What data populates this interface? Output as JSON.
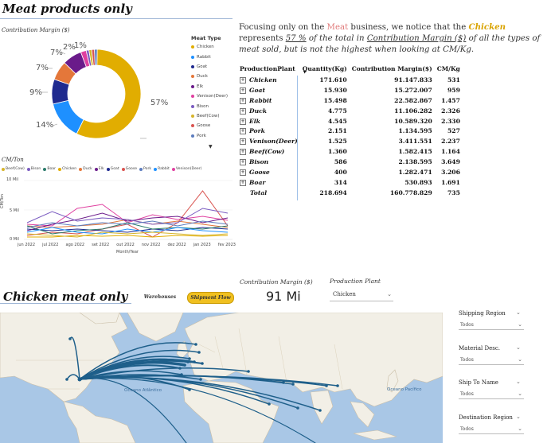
{
  "header1": {
    "title": "Meat products only"
  },
  "donut": {
    "title": "Contribution Margin ($)",
    "slices": [
      {
        "name": "Chicken",
        "pct": 57,
        "color": "#e1ad01"
      },
      {
        "name": "Rabbit",
        "pct": 14,
        "color": "#1e90ff"
      },
      {
        "name": "Goat",
        "pct": 9,
        "color": "#1f2a8f"
      },
      {
        "name": "Duck",
        "pct": 7,
        "color": "#e4773a"
      },
      {
        "name": "Elk",
        "pct": 7,
        "color": "#6a1b8a"
      },
      {
        "name": "Venison(Deer)",
        "pct": 2,
        "color": "#e040a0"
      },
      {
        "name": "Bison",
        "pct": 1,
        "color": "#7a5bc0"
      },
      {
        "name": "Beef(Cow)",
        "pct": 1,
        "color": "#d6b42a"
      },
      {
        "name": "Goose",
        "pct": 1,
        "color": "#d9534f"
      },
      {
        "name": "Pork",
        "pct": 1,
        "color": "#5c7cbe"
      }
    ],
    "labels": {
      "p57": "57%",
      "p14": "14%",
      "p9": "9%",
      "p7a": "7%",
      "p7b": "7%",
      "p2": "2%",
      "p1": "1%"
    }
  },
  "legend": {
    "title": "Meat Type",
    "items": [
      {
        "label": "Chicken",
        "color": "#e1ad01"
      },
      {
        "label": "Rabbit",
        "color": "#1e90ff"
      },
      {
        "label": "Goat",
        "color": "#1f2a8f"
      },
      {
        "label": "Duck",
        "color": "#e4773a"
      },
      {
        "label": "Elk",
        "color": "#6a1b8a"
      },
      {
        "label": "Venison(Deer)",
        "color": "#e040a0"
      },
      {
        "label": "Bison",
        "color": "#7a5bc0"
      },
      {
        "label": "Beef(Cow)",
        "color": "#d6b42a"
      },
      {
        "label": "Goose",
        "color": "#d9534f"
      },
      {
        "label": "Pork",
        "color": "#5c7cbe"
      }
    ],
    "more_arrow": "▼"
  },
  "line_chart": {
    "title": "CM/Ton",
    "legend": [
      {
        "label": "Beef(Cow)",
        "color": "#d6b42a"
      },
      {
        "label": "Bison",
        "color": "#7a5bc0"
      },
      {
        "label": "Boar",
        "color": "#2a7a6a"
      },
      {
        "label": "Chicken",
        "color": "#e1ad01"
      },
      {
        "label": "Duck",
        "color": "#e4773a"
      },
      {
        "label": "Elk",
        "color": "#6a1b8a"
      },
      {
        "label": "Goat",
        "color": "#1f2a8f"
      },
      {
        "label": "Goose",
        "color": "#d9534f"
      },
      {
        "label": "Pork",
        "color": "#5c7cbe"
      },
      {
        "label": "Rabbit",
        "color": "#1e90ff"
      },
      {
        "label": "Venison(Deer)",
        "color": "#e040a0"
      }
    ],
    "y_ticks": [
      "10 Mil",
      "5 Mil",
      "0 Mil"
    ],
    "y_label": "CM/Ton",
    "x_ticks": [
      "jun 2022",
      "jul 2022",
      "ago 2022",
      "set 2022",
      "out 2022",
      "nov 2022",
      "dez 2022",
      "jan 2023",
      "fev 2023"
    ],
    "x_label": "Month/Year"
  },
  "paragraph": {
    "p1": "Focusing only on the ",
    "meat": "Meat",
    "p2": " business, we notice that the ",
    "chicken": "Chicken",
    "p3": " represents ",
    "pct": "57 %",
    "p4": " of the total in ",
    "cm": "Contribution Margin ($)",
    "p5": " of all the types of meat sold, but is not the highest when looking at CM/Kg."
  },
  "table": {
    "headers": [
      "ProductionPlant",
      "Quantity(Kg)",
      "Contribution Margin($)",
      "CM/Kg"
    ],
    "rows": [
      [
        "Chicken",
        "171.610",
        "91.147.833",
        "531"
      ],
      [
        "Goat",
        "15.930",
        "15.272.007",
        "959"
      ],
      [
        "Rabbit",
        "15.498",
        "22.582.867",
        "1.457"
      ],
      [
        "Duck",
        "4.775",
        "11.106.282",
        "2.326"
      ],
      [
        "Elk",
        "4.545",
        "10.589.320",
        "2.330"
      ],
      [
        "Pork",
        "2.151",
        "1.134.595",
        "527"
      ],
      [
        "Venison(Deer)",
        "1.525",
        "3.411.551",
        "2.237"
      ],
      [
        "Beef(Cow)",
        "1.360",
        "1.582.415",
        "1.164"
      ],
      [
        "Bison",
        "586",
        "2.138.595",
        "3.649"
      ],
      [
        "Goose",
        "400",
        "1.282.471",
        "3.206"
      ],
      [
        "Boar",
        "314",
        "530.893",
        "1.691"
      ]
    ],
    "total": [
      "Total",
      "218.694",
      "160.778.829",
      "735"
    ],
    "expand_glyph": "+"
  },
  "header2": {
    "title": "Chicken meat only",
    "btn_warehouses": "Warehouses",
    "btn_shipment": "Shipment Flow"
  },
  "kpi": {
    "label": "Contribution Margin ($)",
    "value": "91 Mi"
  },
  "plant_slicer": {
    "label": "Production Plant",
    "value": "Chicken"
  },
  "map": {
    "ocean1": "Oceano Atlântico",
    "ocean2": "Oceano Pacífico"
  },
  "filters": [
    {
      "label": "Shipping Region",
      "value": "Todos"
    },
    {
      "label": "Material Desc.",
      "value": "Todos"
    },
    {
      "label": "Ship To Name",
      "value": "Todos"
    },
    {
      "label": "Destination Region",
      "value": "Todos"
    }
  ],
  "chev": "⌄"
}
